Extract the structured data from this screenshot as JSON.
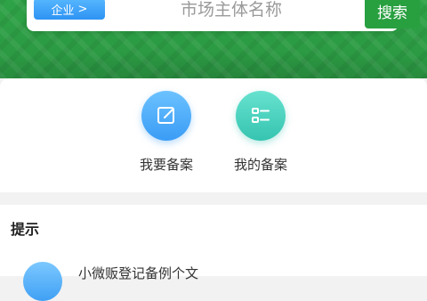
{
  "search": {
    "type_label": "企业",
    "type_chevron": ">",
    "placeholder": "市场主体名称",
    "button_label": "搜索"
  },
  "actions": [
    {
      "label": "我要备案",
      "icon": "edit-icon",
      "color": "#3a9cf5"
    },
    {
      "label": "我的备案",
      "icon": "list-icon",
      "color": "#35c4b0"
    }
  ],
  "tips": {
    "title": "提示",
    "items": [
      {
        "text": "小微贩登记备例个文"
      }
    ]
  },
  "colors": {
    "brand_green": "#2b9a43",
    "accent_blue": "#2e93f3",
    "underline_red": "#e2383d"
  }
}
